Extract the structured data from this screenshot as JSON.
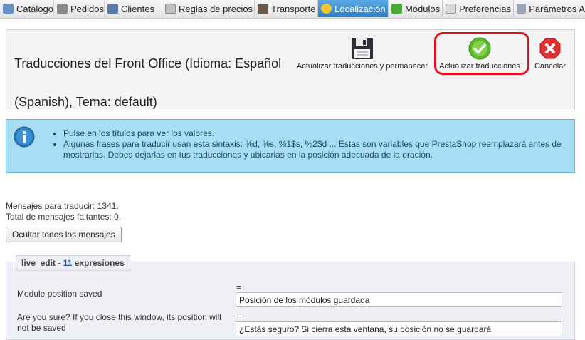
{
  "tabs": [
    {
      "label": "Catálogo",
      "icon": "catalog-icon",
      "active": false
    },
    {
      "label": "Pedidos",
      "icon": "cart-icon",
      "active": false
    },
    {
      "label": "Clientes",
      "icon": "customers-icon",
      "active": false
    },
    {
      "label": "Reglas de precios",
      "icon": "price-rules-icon",
      "active": false
    },
    {
      "label": "Transporte",
      "icon": "truck-icon",
      "active": false
    },
    {
      "label": "Localización",
      "icon": "globe-icon",
      "active": true
    },
    {
      "label": "Módulos",
      "icon": "puzzle-icon",
      "active": false
    },
    {
      "label": "Preferencias",
      "icon": "preferences-icon",
      "active": false
    },
    {
      "label": "Parámetros A",
      "icon": "wrench-icon",
      "active": false
    }
  ],
  "header": {
    "title": "Traducciones del Front Office (Idioma: Español (Spanish), Tema: default)",
    "save_stay_label": "Actualizar traducciones y permanecer",
    "save_label": "Actualizar traducciones",
    "cancel_label": "Cancelar"
  },
  "info": {
    "items": [
      "Pulse en los títulos para ver los valores.",
      "Algunas frases para traducir usan esta sintaxis: %d, %s, %1$s, %2$d ... Estas son variables que PrestaShop reemplazará antes de mostrarlas. Debes dejarlas en tus traducciones y ubicarlas en la posición adecuada de la oración."
    ]
  },
  "stats": {
    "to_translate": "Mensajes para traducir: 1341.",
    "missing": "Total de mensajes faltantes: 0."
  },
  "hide_all_label": "Ocultar todos los mensajes",
  "section": {
    "name": "live_edit",
    "separator": " - ",
    "count": "11",
    "suffix": " expresiones",
    "rows": [
      {
        "label": "Module position saved",
        "eq": "=",
        "value": "Posición de los módulos guardada"
      },
      {
        "label": "Are you sure? If you close this window, its position will not be saved",
        "eq": "=",
        "value": "¿Estás seguro? Si cierra esta ventana, su posición no se guardará"
      }
    ]
  },
  "colors": {
    "active_tab": "#2f7fc4",
    "info_bg": "#a9ddf3",
    "highlight": "#e0121f",
    "check_green": "#5cb82a",
    "cancel_red": "#e03030"
  }
}
